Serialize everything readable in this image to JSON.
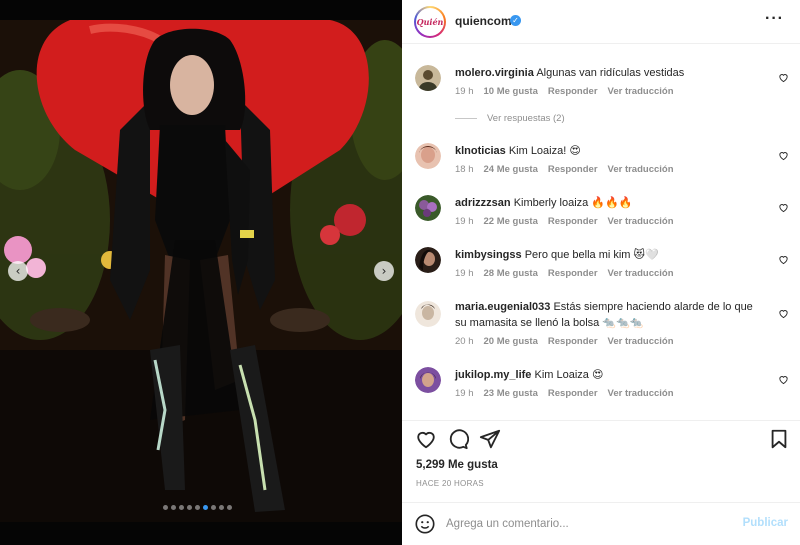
{
  "post": {
    "username": "quiencom",
    "brand_avatar_text": "Quién",
    "likes": "5,299 Me gusta",
    "time_ago": "HACE 20 HORAS",
    "carousel": {
      "total": 9,
      "active": 6
    }
  },
  "comments": [
    {
      "user": "molero.virginia",
      "text": "Algunas van ridículas vestidas",
      "age": "19 h",
      "likes": "10 Me gusta",
      "reply": "Responder",
      "translate": "Ver traducción",
      "avatar_color": "#c8b89a"
    },
    {
      "user": "klnoticias",
      "text": "Kim Loaiza! 😍",
      "age": "18 h",
      "likes": "24 Me gusta",
      "reply": "Responder",
      "translate": "Ver traducción",
      "avatar_color": "#d9a08b"
    },
    {
      "user": "adrizzzsan",
      "text": "Kimberly loaiza 🔥🔥🔥",
      "age": "19 h",
      "likes": "22 Me gusta",
      "reply": "Responder",
      "translate": "Ver traducción",
      "avatar_color": "#8a5a9a"
    },
    {
      "user": "kimbysingss",
      "text": "Pero que bella mi kim 😻🤍",
      "age": "19 h",
      "likes": "28 Me gusta",
      "reply": "Responder",
      "translate": "Ver traducción",
      "avatar_color": "#6b4a3a"
    },
    {
      "user": "maria.eugenial033",
      "text": "Estás siempre haciendo alarde de lo que su mamasita se llenó la bolsa 🐀🐀🐀",
      "age": "20 h",
      "likes": "20 Me gusta",
      "reply": "Responder",
      "translate": "Ver traducción",
      "avatar_color": "#c9b6a2"
    },
    {
      "user": "jukilop.my_life",
      "text": "Kim Loaiza 😍",
      "age": "19 h",
      "likes": "23 Me gusta",
      "reply": "Responder",
      "translate": "Ver traducción",
      "avatar_color": "#7c4fa0"
    }
  ],
  "replies_label": "Ver respuestas (2)",
  "composer": {
    "placeholder": "Agrega un comentario...",
    "post_label": "Publicar"
  },
  "colors": {
    "accent": "#3897f0",
    "post_disabled": "#b2dffc",
    "muted": "#8e8e8e"
  }
}
